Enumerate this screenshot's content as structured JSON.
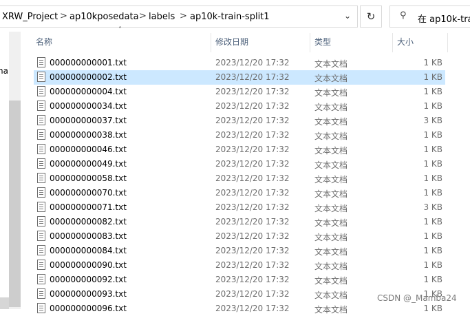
{
  "address_bar": {
    "crumbs": [
      "XRW_Project",
      "ap10kposedata",
      "labels",
      "ap10k-train-split1"
    ],
    "separator": ">",
    "dropdown_icon": "chevron-down-icon",
    "refresh_icon": "refresh-icon"
  },
  "search": {
    "icon": "search-icon",
    "placeholder": "在 ap10k-trai"
  },
  "nav_pane": {
    "partial_text": "na"
  },
  "columns": {
    "name": "名称",
    "date": "修改日期",
    "type": "类型",
    "size": "大小"
  },
  "files": [
    {
      "name": "000000000001.txt",
      "date": "2023/12/20 17:32",
      "type": "文本文档",
      "size": "1 KB"
    },
    {
      "name": "000000000002.txt",
      "date": "2023/12/20 17:32",
      "type": "文本文档",
      "size": "1 KB",
      "selected": true
    },
    {
      "name": "000000000004.txt",
      "date": "2023/12/20 17:32",
      "type": "文本文档",
      "size": "1 KB"
    },
    {
      "name": "000000000034.txt",
      "date": "2023/12/20 17:32",
      "type": "文本文档",
      "size": "1 KB"
    },
    {
      "name": "000000000037.txt",
      "date": "2023/12/20 17:32",
      "type": "文本文档",
      "size": "3 KB"
    },
    {
      "name": "000000000038.txt",
      "date": "2023/12/20 17:32",
      "type": "文本文档",
      "size": "1 KB"
    },
    {
      "name": "000000000046.txt",
      "date": "2023/12/20 17:32",
      "type": "文本文档",
      "size": "1 KB"
    },
    {
      "name": "000000000049.txt",
      "date": "2023/12/20 17:32",
      "type": "文本文档",
      "size": "1 KB"
    },
    {
      "name": "000000000058.txt",
      "date": "2023/12/20 17:32",
      "type": "文本文档",
      "size": "1 KB"
    },
    {
      "name": "000000000070.txt",
      "date": "2023/12/20 17:32",
      "type": "文本文档",
      "size": "1 KB"
    },
    {
      "name": "000000000071.txt",
      "date": "2023/12/20 17:32",
      "type": "文本文档",
      "size": "3 KB"
    },
    {
      "name": "000000000082.txt",
      "date": "2023/12/20 17:32",
      "type": "文本文档",
      "size": "1 KB"
    },
    {
      "name": "000000000083.txt",
      "date": "2023/12/20 17:32",
      "type": "文本文档",
      "size": "1 KB"
    },
    {
      "name": "000000000084.txt",
      "date": "2023/12/20 17:32",
      "type": "文本文档",
      "size": "1 KB"
    },
    {
      "name": "000000000090.txt",
      "date": "2023/12/20 17:32",
      "type": "文本文档",
      "size": "1 KB"
    },
    {
      "name": "000000000092.txt",
      "date": "2023/12/20 17:32",
      "type": "文本文档",
      "size": "1 KB"
    },
    {
      "name": "000000000093.txt",
      "date": "2023/12/20 17:32",
      "type": "文本文档",
      "size": "1 KB"
    },
    {
      "name": "000000000096.txt",
      "date": "2023/12/20 17:32",
      "type": "文本文档",
      "size": "1 KB"
    }
  ],
  "watermark": "CSDN @_Mamba24",
  "colors": {
    "selection": "#cce8ff",
    "header_text": "#4c607a",
    "secondary_text": "#6d6d6d"
  }
}
